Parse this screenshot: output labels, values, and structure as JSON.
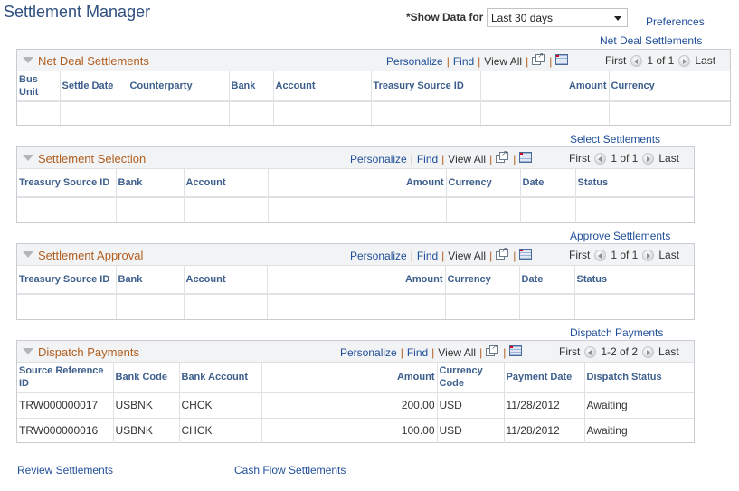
{
  "page": {
    "title": "Settlement Manager",
    "show_data_label": "*Show Data for",
    "show_data_value": "Last 30 days",
    "preferences_link": "Preferences"
  },
  "toolbar": {
    "personalize": "Personalize",
    "find": "Find",
    "view_all": "View All",
    "separator": "|",
    "first": "First",
    "last": "Last"
  },
  "grids": {
    "net_deal": {
      "link": "Net Deal Settlements",
      "title": "Net Deal Settlements",
      "range": "1 of 1",
      "columns": [
        "Bus Unit",
        "Settle Date",
        "Counterparty",
        "Bank",
        "Account",
        "Treasury Source ID",
        "Amount",
        "Currency"
      ],
      "rows": []
    },
    "selection": {
      "link": "Select Settlements",
      "title": "Settlement Selection",
      "range": "1 of 1",
      "columns": [
        "Treasury Source ID",
        "Bank",
        "Account",
        "Amount",
        "Currency",
        "Date",
        "Status"
      ],
      "rows": []
    },
    "approval": {
      "link": "Approve Settlements",
      "title": "Settlement Approval",
      "range": "1 of 1",
      "columns": [
        "Treasury Source ID",
        "Bank",
        "Account",
        "Amount",
        "Currency",
        "Date",
        "Status"
      ],
      "rows": []
    },
    "dispatch": {
      "link": "Dispatch Payments",
      "title": "Dispatch Payments",
      "range": "1-2 of 2",
      "columns": [
        "Source Reference ID",
        "Bank Code",
        "Bank Account",
        "Amount",
        "Currency Code",
        "Payment Date",
        "Dispatch Status"
      ],
      "rows": [
        [
          "TRW000000017",
          "USBNK",
          "CHCK",
          "200.00",
          "USD",
          "11/28/2012",
          "Awaiting"
        ],
        [
          "TRW000000016",
          "USBNK",
          "CHCK",
          "100.00",
          "USD",
          "11/28/2012",
          "Awaiting"
        ]
      ]
    }
  },
  "footer": {
    "review_link": "Review Settlements",
    "cash_flow_link": "Cash Flow Settlements"
  }
}
